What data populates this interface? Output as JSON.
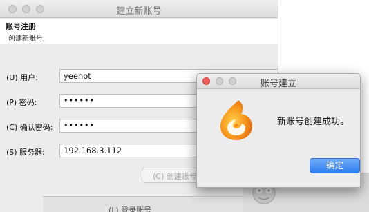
{
  "main_window": {
    "title": "建立新账号",
    "header": {
      "title": "账号注册",
      "subtitle": "创建新账号."
    },
    "fields": [
      {
        "label": "(U) 用户:",
        "value": "yeehot"
      },
      {
        "label": "(P) 密码:",
        "value": "••••••"
      },
      {
        "label": "(C) 确认密码:",
        "value": "••••••"
      },
      {
        "label": "(S) 服务器:",
        "value": "192.168.3.112"
      }
    ],
    "create_button": "(C) 创建账号",
    "bottom_item": "(L) 登录账号"
  },
  "dialog": {
    "title": "账号建立",
    "message": "新账号创建成功。",
    "ok_button": "确定",
    "icon": "app-flame-logo-icon"
  },
  "colors": {
    "ok_button": "#3d86f2",
    "close_button": "#ec5f5a",
    "logo_orange": "#f28a1c"
  }
}
